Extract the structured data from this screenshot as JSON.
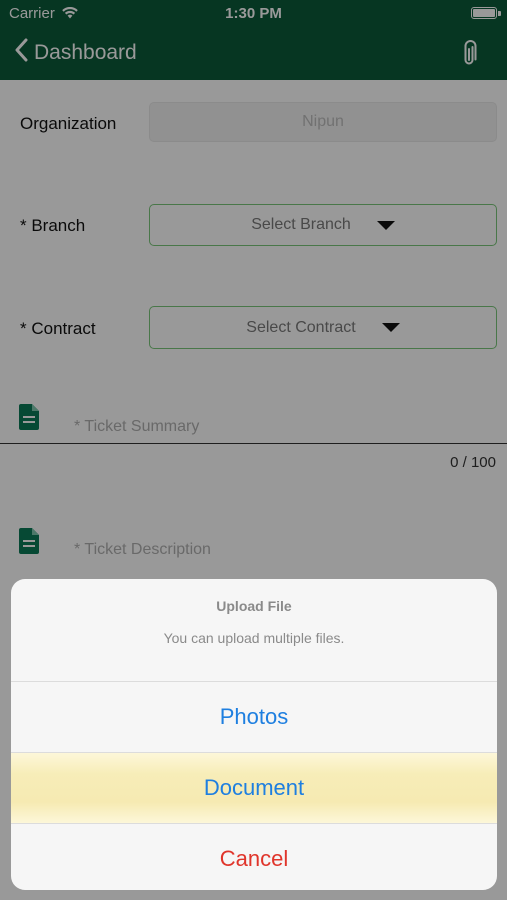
{
  "status_bar": {
    "carrier": "Carrier",
    "time": "1:30 PM"
  },
  "nav": {
    "back_label": "Dashboard",
    "attach_icon": "paperclip-icon"
  },
  "form": {
    "organization": {
      "label": "Organization",
      "value": "Nipun"
    },
    "branch": {
      "label": "* Branch",
      "placeholder": "Select Branch"
    },
    "contract": {
      "label": "* Contract",
      "placeholder": "Select Contract"
    },
    "summary": {
      "placeholder": "* Ticket Summary",
      "counter": "0 / 100"
    },
    "description": {
      "placeholder": "* Ticket Description"
    }
  },
  "action_sheet": {
    "title": "Upload File",
    "message": "You can upload multiple files.",
    "buttons": [
      {
        "label": "Photos"
      },
      {
        "label": "Document"
      },
      {
        "label": "Cancel"
      }
    ]
  },
  "colors": {
    "header_green": "#0b5a3a",
    "select_border": "#7bc77b",
    "ios_blue": "#1e7fe0",
    "destructive_red": "#e0352b"
  }
}
